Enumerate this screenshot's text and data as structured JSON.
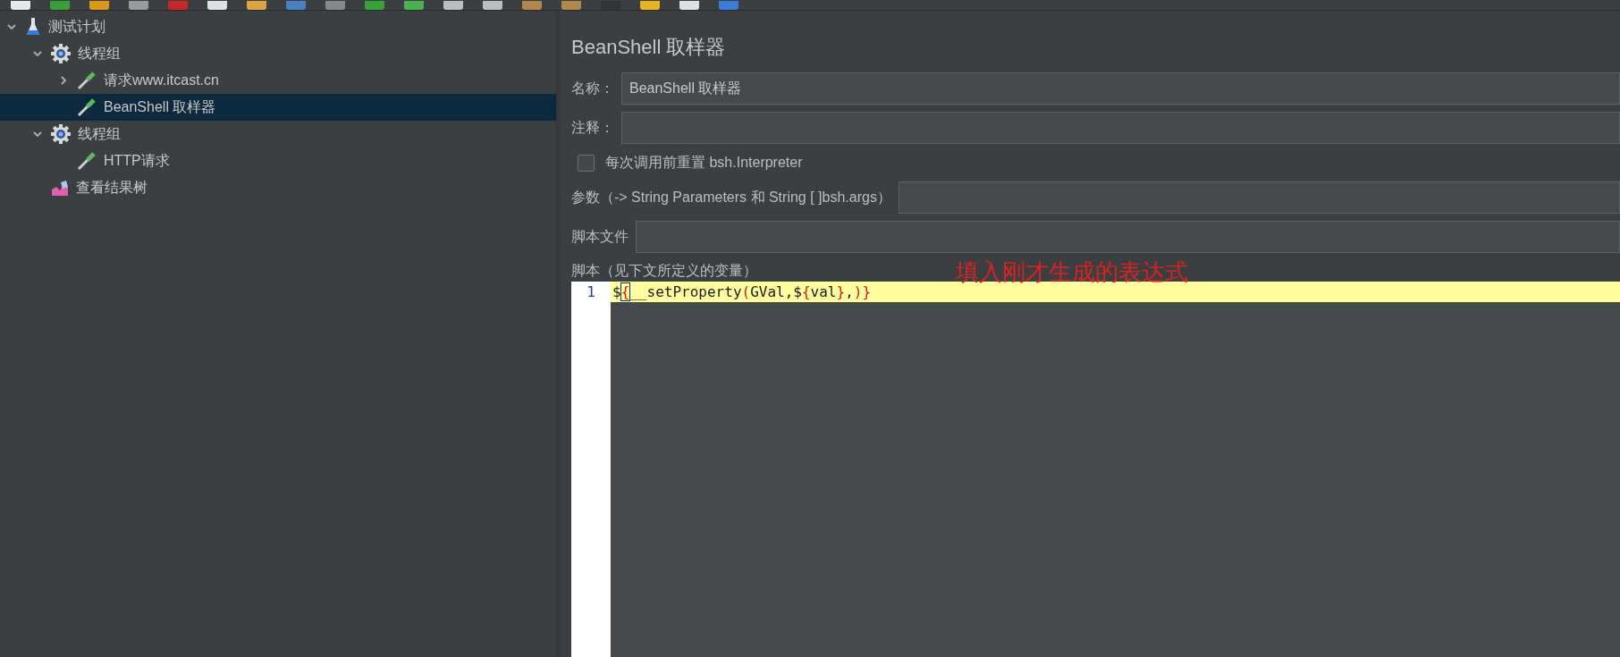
{
  "tree": [
    {
      "label": "测试计划",
      "kind": "plan",
      "expanded": true,
      "selected": false,
      "children": [
        {
          "label": "线程组",
          "kind": "thread-group",
          "expanded": true,
          "selected": false,
          "children": [
            {
              "label": "请求www.itcast.cn",
              "kind": "sampler",
              "expanded": false,
              "selected": false
            },
            {
              "label": "BeanShell 取样器",
              "kind": "sampler",
              "selected": true
            }
          ]
        },
        {
          "label": "线程组",
          "kind": "thread-group",
          "expanded": true,
          "selected": false,
          "children": [
            {
              "label": "HTTP请求",
              "kind": "sampler",
              "selected": false
            }
          ]
        },
        {
          "label": "查看结果树",
          "kind": "listener",
          "selected": false
        }
      ]
    }
  ],
  "panel": {
    "title": "BeanShell 取样器",
    "name": {
      "label": "名称：",
      "value": "BeanShell 取样器"
    },
    "comment": {
      "label": "注释："
    },
    "reset": {
      "label": "每次调用前重置 bsh.Interpreter",
      "checked": false
    },
    "params": {
      "label": "参数（-> String Parameters 和 String [ ]bsh.args）"
    },
    "script_file": {
      "label": "脚本文件"
    },
    "script_label": "脚本（见下文所定义的变量）",
    "editor": {
      "line_number": "1",
      "tokens": [
        {
          "text": "$",
          "kind": "plain"
        },
        {
          "text": "{",
          "kind": "matched-bracket"
        },
        {
          "text": "__setProperty",
          "kind": "plain"
        },
        {
          "text": "(",
          "kind": "bracket"
        },
        {
          "text": "GVal,$",
          "kind": "plain"
        },
        {
          "text": "{",
          "kind": "bracket"
        },
        {
          "text": "val",
          "kind": "plain"
        },
        {
          "text": "}",
          "kind": "bracket"
        },
        {
          "text": ",",
          "kind": "plain"
        },
        {
          "text": ")}",
          "kind": "bracket"
        }
      ]
    },
    "annotation": "填入刚才生成的表达式"
  }
}
